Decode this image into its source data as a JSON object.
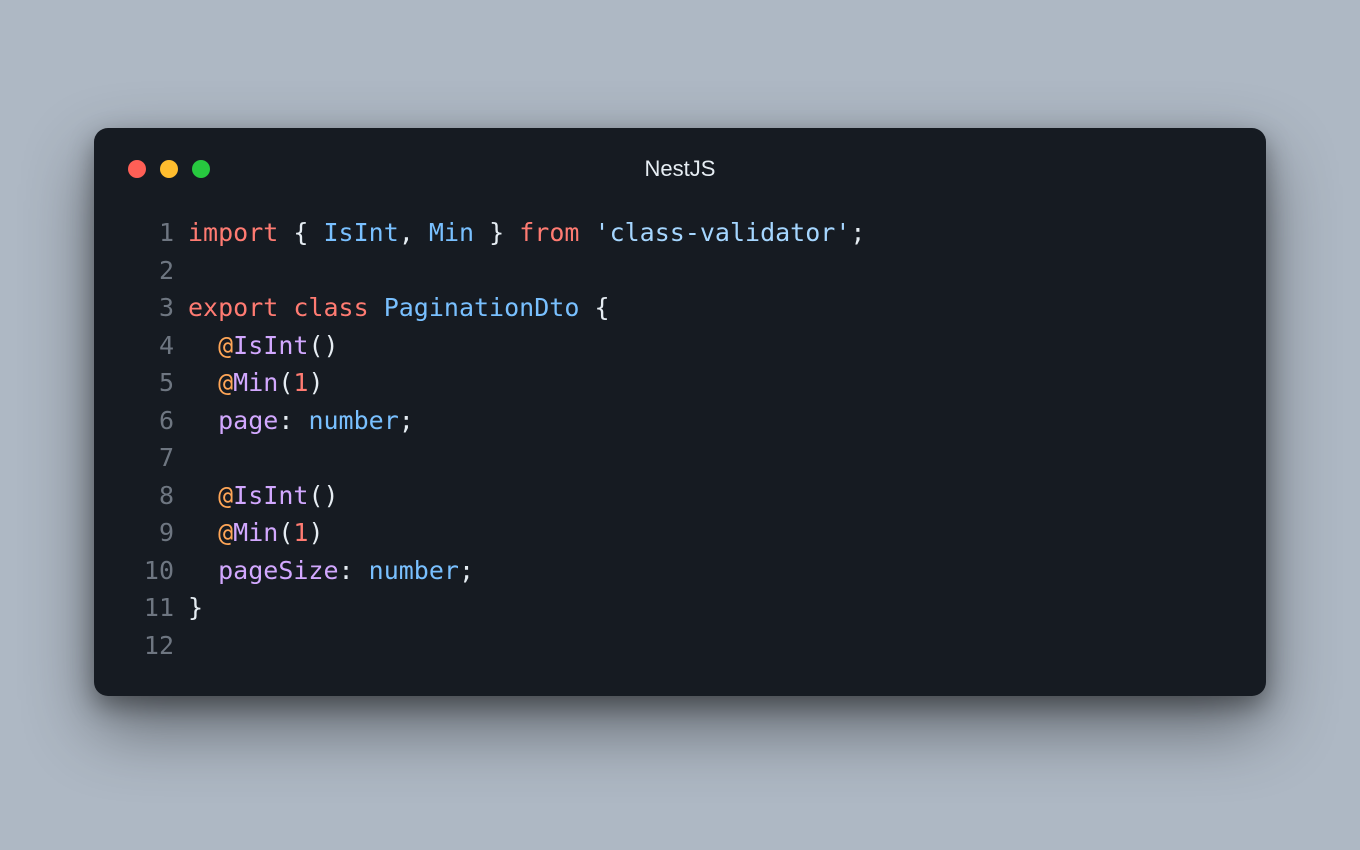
{
  "window": {
    "title": "NestJS"
  },
  "traffic": {
    "red": "close-icon",
    "yellow": "minimize-icon",
    "green": "zoom-icon"
  },
  "code": {
    "ln1": "1",
    "ln2": "2",
    "ln3": "3",
    "ln4": "4",
    "ln5": "5",
    "ln6": "6",
    "ln7": "7",
    "ln8": "8",
    "ln9": "9",
    "ln10": "10",
    "ln11": "11",
    "ln12": "12",
    "l1": {
      "kw1": "import",
      "sp1": " ",
      "b1": "{",
      "sp2": " ",
      "id1": "IsInt",
      "c1": ",",
      "sp3": " ",
      "id2": "Min",
      "sp4": " ",
      "b2": "}",
      "sp5": " ",
      "kw2": "from",
      "sp6": " ",
      "q1": "'class-validator'",
      "sc": ";"
    },
    "l3": {
      "kw1": "export",
      "sp1": " ",
      "kw2": "class",
      "sp2": " ",
      "cls": "PaginationDto",
      "sp3": " ",
      "b": "{"
    },
    "l4": {
      "ind": "  ",
      "at": "@",
      "fn": "IsInt",
      "pp": "()"
    },
    "l5": {
      "ind": "  ",
      "at": "@",
      "fn": "Min",
      "po": "(",
      "num": "1",
      "pc": ")"
    },
    "l6": {
      "ind": "  ",
      "prop": "page",
      "col": ":",
      "sp": " ",
      "typ": "number",
      "sc": ";"
    },
    "l8": {
      "ind": "  ",
      "at": "@",
      "fn": "IsInt",
      "pp": "()"
    },
    "l9": {
      "ind": "  ",
      "at": "@",
      "fn": "Min",
      "po": "(",
      "num": "1",
      "pc": ")"
    },
    "l10": {
      "ind": "  ",
      "prop": "pageSize",
      "col": ":",
      "sp": " ",
      "typ": "number",
      "sc": ";"
    },
    "l11": {
      "b": "}"
    }
  }
}
